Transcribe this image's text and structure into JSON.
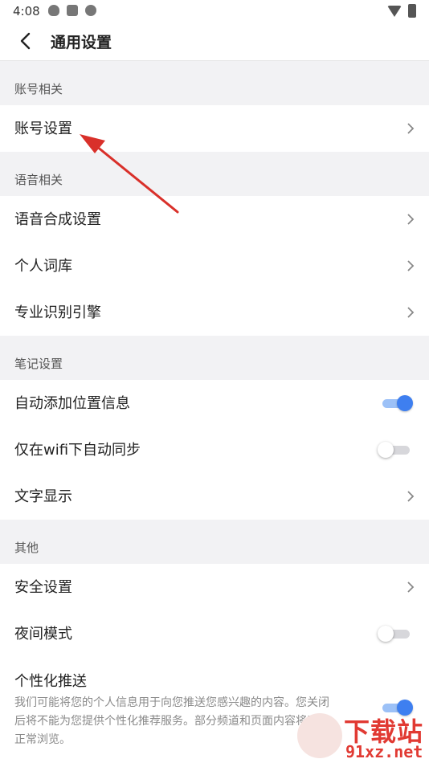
{
  "status": {
    "time": "4:08"
  },
  "header": {
    "title": "通用设置"
  },
  "sections": [
    {
      "title": "账号相关",
      "items": [
        {
          "label": "账号设置",
          "type": "link"
        }
      ]
    },
    {
      "title": "语音相关",
      "items": [
        {
          "label": "语音合成设置",
          "type": "link"
        },
        {
          "label": "个人词库",
          "type": "link"
        },
        {
          "label": "专业识别引擎",
          "type": "link"
        }
      ]
    },
    {
      "title": "笔记设置",
      "items": [
        {
          "label": "自动添加位置信息",
          "type": "toggle",
          "on": true
        },
        {
          "label": "仅在wifi下自动同步",
          "type": "toggle",
          "on": false
        },
        {
          "label": "文字显示",
          "type": "link"
        }
      ]
    },
    {
      "title": "其他",
      "items": [
        {
          "label": "安全设置",
          "type": "link"
        },
        {
          "label": "夜间模式",
          "type": "toggle",
          "on": false
        },
        {
          "label": "个性化推送",
          "type": "toggle",
          "on": true,
          "description": "我们可能将您的个人信息用于向您推送您感兴趣的内容。您关闭后将不能为您提供个性化推荐服务。部分频道和页面内容将无法正常浏览。"
        }
      ]
    }
  ],
  "watermark": {
    "text": "下载站",
    "url": "91xz.net"
  },
  "colors": {
    "accent": "#3e7ff0",
    "annotation_arrow": "#d9302a",
    "watermark": "#e13a33"
  },
  "icons": {
    "back": "back-arrow-icon",
    "chevron": "chevron-right-icon"
  }
}
